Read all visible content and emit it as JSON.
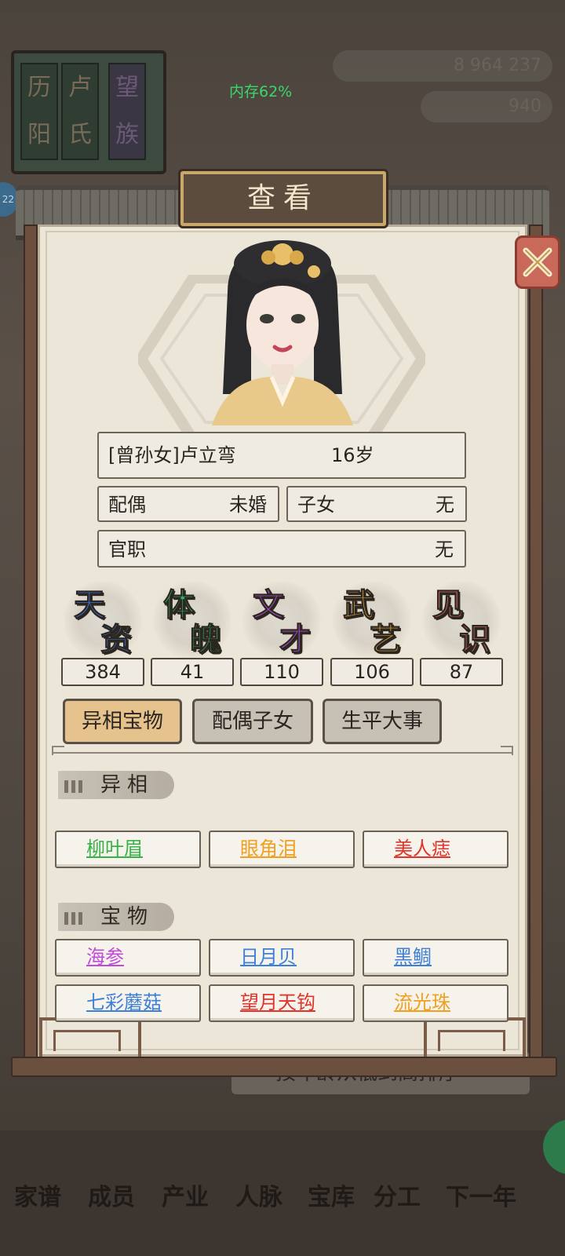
{
  "background": {
    "family_book": {
      "left_label": "历阳",
      "middle_label": "卢氏",
      "right_label": "望族"
    },
    "resources": {
      "line1": "8  964  237",
      "line2": "940"
    },
    "memory": "内存62%",
    "badge": "22",
    "sort_label": "按年龄从低到高排序",
    "nav": [
      "家谱",
      "成员",
      "产业",
      "人脉",
      "宝库",
      "分工",
      "下一年"
    ]
  },
  "dialog": {
    "title": "查看",
    "name_line": "[曾孙女]卢立弯",
    "age": "16岁",
    "spouse_label": "配偶",
    "spouse_value": "未婚",
    "children_label": "子女",
    "children_value": "无",
    "office_label": "官职",
    "office_value": "无",
    "stats": [
      {
        "c1": "天",
        "c2": "资",
        "value": "384",
        "color": "#3d6fd8"
      },
      {
        "c1": "体",
        "c2": "魄",
        "value": "41",
        "color": "#2fb56a"
      },
      {
        "c1": "文",
        "c2": "才",
        "value": "110",
        "color": "#b14fd6"
      },
      {
        "c1": "武",
        "c2": "艺",
        "value": "106",
        "color": "#e8a93a"
      },
      {
        "c1": "见",
        "c2": "识",
        "value": "87",
        "color": "#e56a6a"
      }
    ],
    "tabs": [
      "异相宝物",
      "配偶子女",
      "生平大事"
    ],
    "traits_header": "异相",
    "traits": [
      {
        "label": "柳叶眉",
        "color": "#39b24a"
      },
      {
        "label": "眼角泪",
        "color": "#f0a020"
      },
      {
        "label": "美人痣",
        "color": "#e0342c"
      }
    ],
    "treasures_header": "宝物",
    "treasures": [
      {
        "label": "海参",
        "color": "#c24ad8"
      },
      {
        "label": "日月贝",
        "color": "#3e7fd8"
      },
      {
        "label": "黑鲷",
        "color": "#3e7fd8"
      },
      {
        "label": "七彩蘑菇",
        "color": "#3e7fd8"
      },
      {
        "label": "望月天钩",
        "color": "#e0342c"
      },
      {
        "label": "流光珠",
        "color": "#f0a020"
      }
    ]
  }
}
